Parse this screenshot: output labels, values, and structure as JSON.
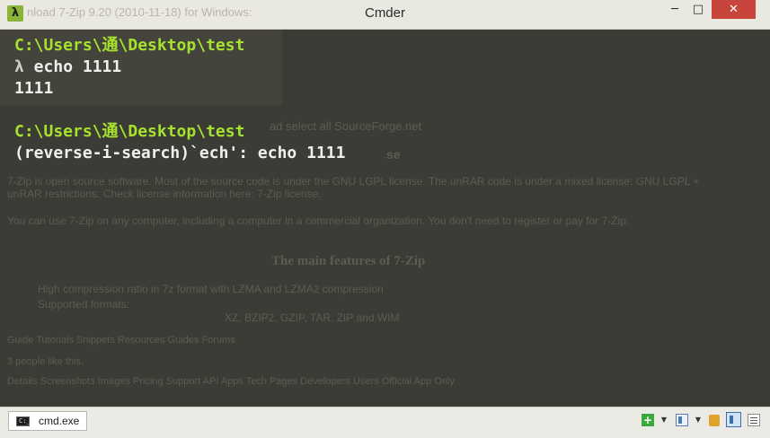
{
  "titlebar": {
    "app_icon_glyph": "λ",
    "ghost_title": "nload 7-Zip 9.20 (2010-11-18) for Windows:",
    "title": "Cmder",
    "minimize_glyph": "─",
    "maximize_glyph": "□",
    "close_glyph": "✕"
  },
  "terminal": {
    "lines": [
      {
        "prompt": "C:\\Users\\通\\Desktop\\test"
      },
      {
        "lambda": "λ",
        "command": " echo 1111"
      },
      {
        "output": "1111"
      },
      {
        "prompt": "C:\\Users\\通\\Desktop\\test"
      },
      {
        "output": "(reverse-i-search)`ech': echo 1111"
      }
    ],
    "colors": {
      "prompt": "#a6e22e",
      "text": "#f0f0ec",
      "background": "#3c3c36"
    }
  },
  "background_ghost": {
    "line_1": "ad select all SourceForge.net",
    "line_2": "se",
    "line_3": "7-Zip is open source software. Most of the source code is under the GNU LGPL license. The unRAR code is under a mixed license: GNU LGPL + unRAR restrictions. Check license information here: 7-Zip license.",
    "line_4": "You can use 7-Zip on any computer, including a computer in a commercial organization. You don't need to register or pay for 7-Zip.",
    "heading": "The main features of 7-Zip",
    "bullet_1": "High compression ratio in 7z format with LZMA and LZMA2 compression",
    "bullet_2": "Supported formats:",
    "formats": "XZ, BZIP2, GZIP, TAR, ZIP and WIM",
    "tabs_row": "Guide  Tutorials  Snippets  Resources  Guides  Forums",
    "people": "3 people like this.",
    "menu_row": "Details   Screenshots   Images   Pricing   Support   API   Apps   Tech Pages   Developers   Users   Official App Only"
  },
  "tabbar": {
    "tab_label": "cmd.exe",
    "add_glyph": "+",
    "dropdown_glyph": "▼"
  }
}
